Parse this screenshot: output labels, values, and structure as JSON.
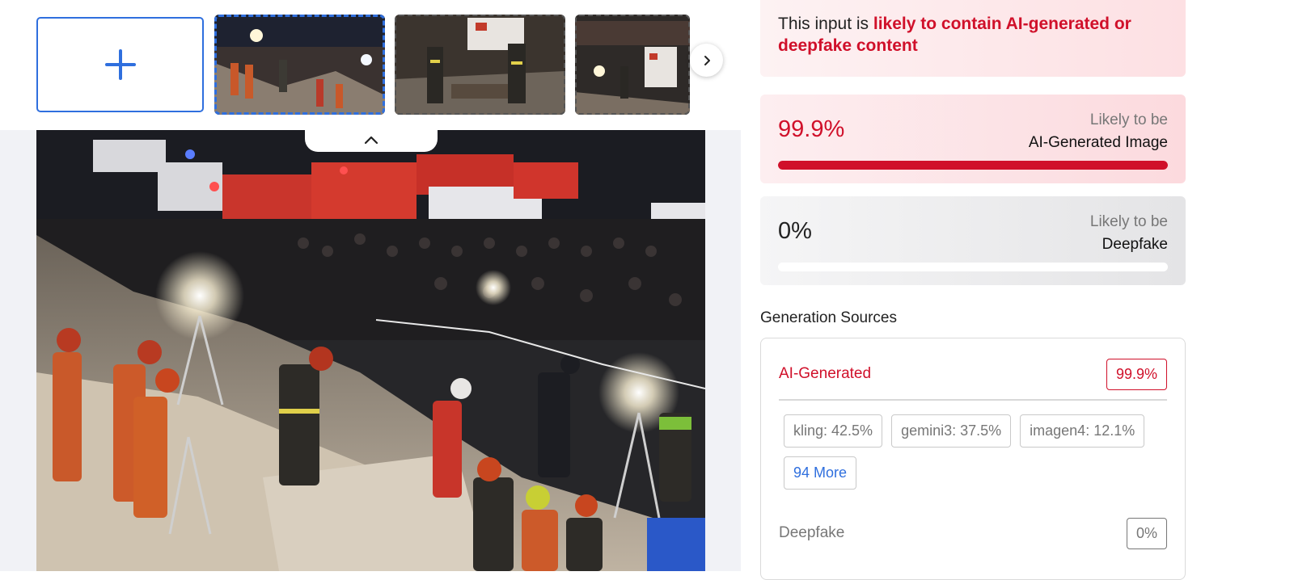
{
  "verdict": {
    "prefix": "This input is ",
    "highlight": "likely to contain AI-generated or deepfake content"
  },
  "scores": {
    "ai": {
      "value": "99.9%",
      "fraction": 0.999,
      "caption_top": "Likely to be",
      "caption_bottom": "AI-Generated Image"
    },
    "deepfake": {
      "value": "0%",
      "fraction": 0.0,
      "caption_top": "Likely to be",
      "caption_bottom": "Deepfake"
    }
  },
  "sources": {
    "title": "Generation Sources",
    "ai": {
      "label": "AI-Generated",
      "value": "99.9%"
    },
    "chips": [
      "kling: 42.5%",
      "gemini3: 37.5%",
      "imagen4: 12.1%"
    ],
    "more": "94 More",
    "deepfake": {
      "label": "Deepfake",
      "value": "0%"
    }
  },
  "icons": {
    "add": "plus-icon",
    "next": "chevron-right-icon",
    "collapse": "chevron-up-icon"
  },
  "colors": {
    "accent_blue": "#2f6fde",
    "alert_red": "#d0102a"
  }
}
